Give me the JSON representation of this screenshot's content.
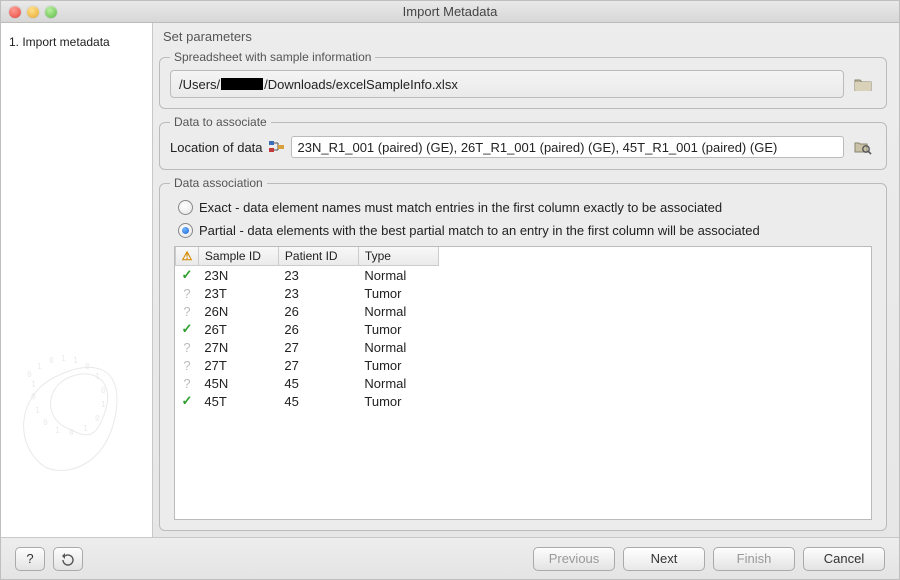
{
  "window": {
    "title": "Import Metadata"
  },
  "sidebar": {
    "step": "1.  Import metadata"
  },
  "main": {
    "set_params": "Set parameters",
    "spreadsheet": {
      "legend": "Spreadsheet with sample information",
      "path_prefix": "/Users/",
      "path_suffix": "/Downloads/excelSampleInfo.xlsx"
    },
    "data_to_assoc": {
      "legend": "Data to associate",
      "label": "Location of data",
      "value": "23N_R1_001 (paired) (GE), 26T_R1_001 (paired) (GE), 45T_R1_001 (paired) (GE)"
    },
    "data_assoc": {
      "legend": "Data association",
      "exact": "Exact - data element names must match entries in the first column exactly to be associated",
      "partial": "Partial - data elements with the best partial match to an entry in the first column will be associated",
      "selected": "partial",
      "columns": {
        "c1": "Sample ID",
        "c2": "Patient ID",
        "c3": "Type"
      },
      "rows": [
        {
          "status": "check",
          "sample": "23N",
          "patient": "23",
          "type": "Normal"
        },
        {
          "status": "ques",
          "sample": "23T",
          "patient": "23",
          "type": "Tumor"
        },
        {
          "status": "ques",
          "sample": "26N",
          "patient": "26",
          "type": "Normal"
        },
        {
          "status": "check",
          "sample": "26T",
          "patient": "26",
          "type": "Tumor"
        },
        {
          "status": "ques",
          "sample": "27N",
          "patient": "27",
          "type": "Normal"
        },
        {
          "status": "ques",
          "sample": "27T",
          "patient": "27",
          "type": "Tumor"
        },
        {
          "status": "ques",
          "sample": "45N",
          "patient": "45",
          "type": "Normal"
        },
        {
          "status": "check",
          "sample": "45T",
          "patient": "45",
          "type": "Tumor"
        }
      ]
    }
  },
  "footer": {
    "help": "?",
    "previous": "Previous",
    "next": "Next",
    "finish": "Finish",
    "cancel": "Cancel"
  }
}
